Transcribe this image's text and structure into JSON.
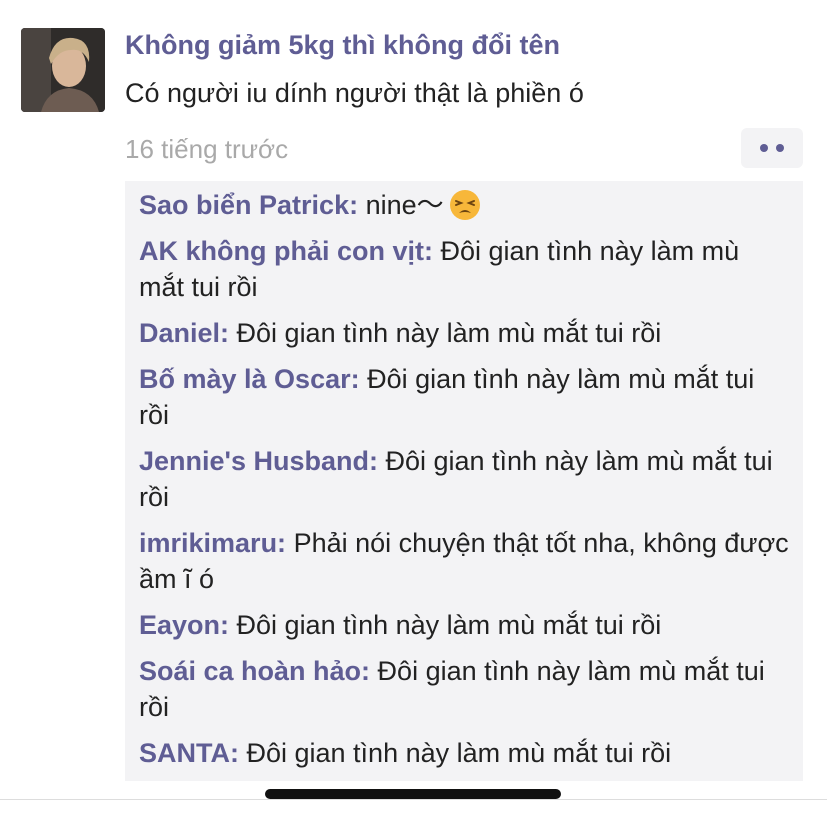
{
  "post": {
    "author": "Không giảm 5kg thì không đổi tên",
    "content": "Có người iu dính người thật là phiền ó",
    "time": "16 tiếng trước",
    "more_icon": "more-dots-icon"
  },
  "comments": [
    {
      "name": "Sao biển Patrick:",
      "text": " nine",
      "emoji": "tired-face-emoji"
    },
    {
      "name": "AK không phải con vịt:",
      "text": " Đôi gian tình này làm mù mắt tui rồi"
    },
    {
      "name": "Daniel:",
      "text": " Đôi gian tình này làm mù mắt tui rồi"
    },
    {
      "name": "Bố mày là Oscar:",
      "text": " Đôi gian tình này làm mù mắt tui rồi"
    },
    {
      "name": "Jennie's Husband:",
      "text": " Đôi gian tình này làm mù mắt tui rồi"
    },
    {
      "name": "imrikimaru:",
      "text": " Phải nói chuyện thật tốt nha, không được ầm ĩ ó"
    },
    {
      "name": "Eayon:",
      "text": " Đôi gian tình này làm mù mắt tui rồi"
    },
    {
      "name": "Soái ca hoàn hảo:",
      "text": " Đôi gian tình này làm mù mắt tui rồi"
    },
    {
      "name": "SANTA:",
      "text": " Đôi gian tình này làm mù mắt tui rồi"
    }
  ],
  "colors": {
    "name": "#5f5d94",
    "text": "#222222",
    "meta": "#a9a9a9",
    "panel": "#f3f3f5"
  }
}
